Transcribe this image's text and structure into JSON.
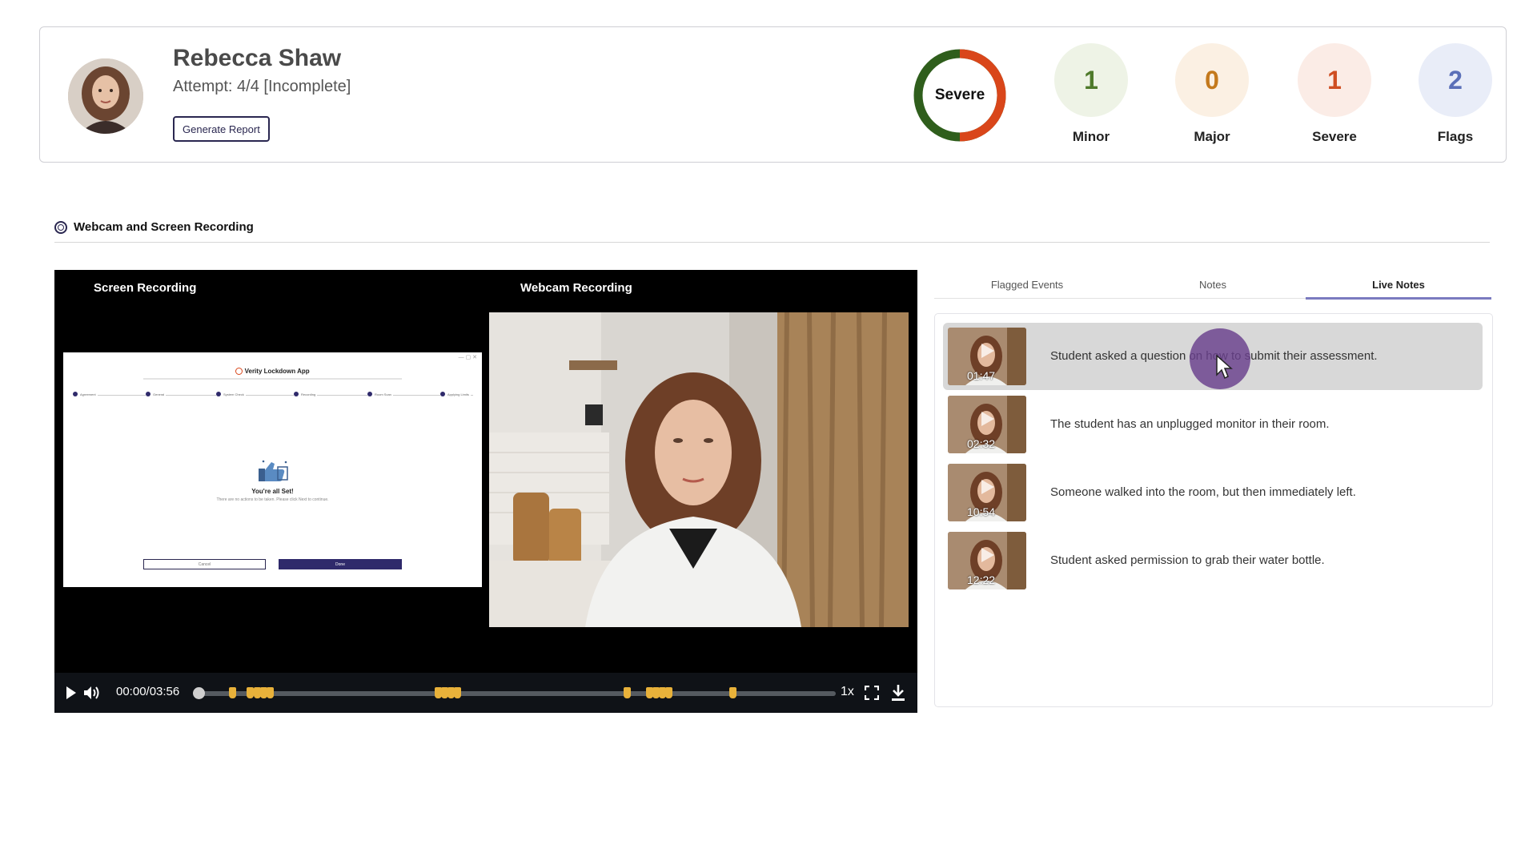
{
  "candidate": {
    "name": "Rebecca Shaw",
    "attempt": "Attempt: 4/4 [Incomplete]",
    "generate_report_label": "Generate Report"
  },
  "severity": {
    "overall_label": "Severe",
    "ring_colors": {
      "safe": "#2f5e1c",
      "risk": "#d9461a"
    },
    "stats": [
      {
        "value": "1",
        "label": "Minor",
        "color": "#4f7a2b",
        "bg": "#eef3e6"
      },
      {
        "value": "0",
        "label": "Major",
        "color": "#c4791c",
        "bg": "#fbf0e3"
      },
      {
        "value": "1",
        "label": "Severe",
        "color": "#cf4e22",
        "bg": "#fbece6"
      },
      {
        "value": "2",
        "label": "Flags",
        "color": "#5a6fb8",
        "bg": "#e9edf8"
      }
    ]
  },
  "section": {
    "title": "Webcam and Screen Recording"
  },
  "player": {
    "screen_label": "Screen Recording",
    "webcam_label": "Webcam Recording",
    "time": "00:00/03:56",
    "speed": "1x",
    "screen_app": {
      "title": "Verity Lockdown App",
      "steps": [
        "Agreement",
        "General",
        "System Check",
        "Recording",
        "Room Scan",
        "Applying Limits"
      ],
      "heading": "You're all Set!",
      "message": "There are no actions to be taken. Please click Next to continue.",
      "cancel": "Cancel",
      "done": "Done"
    }
  },
  "tabs": [
    {
      "label": "Flagged Events",
      "active": false
    },
    {
      "label": "Notes",
      "active": false
    },
    {
      "label": "Live Notes",
      "active": true
    }
  ],
  "notes": [
    {
      "time": "01:47",
      "text": "Student asked a question on how to submit their assessment.",
      "active": true
    },
    {
      "time": "02:32",
      "text": "The student has an unplugged monitor in their room.",
      "active": false
    },
    {
      "time": "10:54",
      "text": "Someone walked into the room, but then immediately left.",
      "active": false
    },
    {
      "time": "12:22",
      "text": "Student asked permission to grab their water bottle.",
      "active": false
    }
  ]
}
